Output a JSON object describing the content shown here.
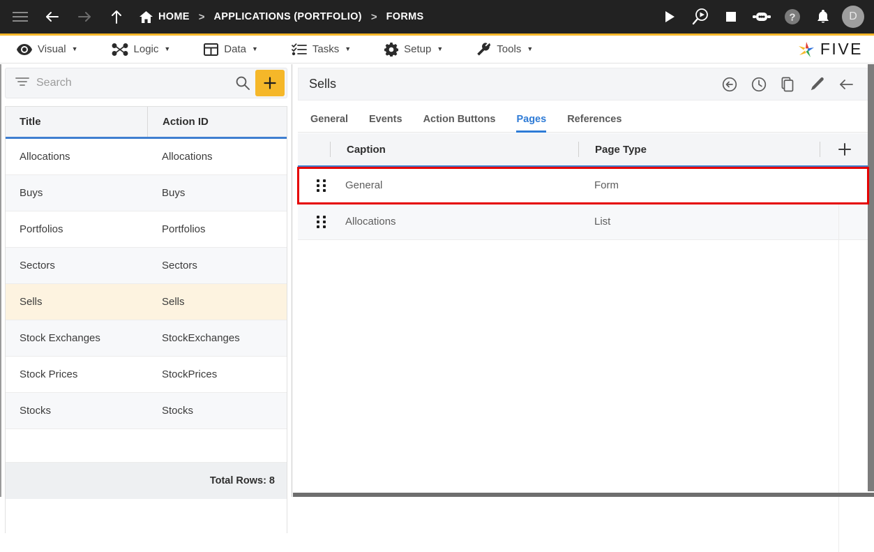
{
  "topbar": {
    "icons": [
      "menu-icon",
      "back-arrow-icon",
      "forward-arrow-icon",
      "up-arrow-icon"
    ],
    "home_label": "HOME",
    "sep": ">",
    "crumb2": "APPLICATIONS (PORTFOLIO)",
    "crumb3": "FORMS",
    "right_icons": [
      "play-icon",
      "debug-search-icon",
      "stop-icon",
      "chatbot-icon",
      "help-icon",
      "bell-icon"
    ],
    "avatar_initial": "D",
    "accent_color": "#f5b729",
    "background_color": "#222222"
  },
  "menubar": {
    "items": [
      {
        "label": "Visual",
        "icon": "eye-icon",
        "caret": "▼"
      },
      {
        "label": "Logic",
        "icon": "logic-nodes-icon",
        "caret": "▼"
      },
      {
        "label": "Data",
        "icon": "table-grid-icon",
        "caret": "▼"
      },
      {
        "label": "Tasks",
        "icon": "checklist-icon",
        "caret": "▼"
      },
      {
        "label": "Setup",
        "icon": "gear-icon",
        "caret": "▼"
      },
      {
        "label": "Tools",
        "icon": "tools-icon",
        "caret": "▼"
      }
    ],
    "logo_text": "FIVE",
    "logo_icon": "five-pinwheel-logo"
  },
  "sidebar": {
    "search": {
      "placeholder": "Search",
      "value": "",
      "filter_icon": "filter-icon",
      "search_icon": "search-icon"
    },
    "add_button": {
      "icon": "plus-icon",
      "label": "+",
      "color": "#f5b729"
    },
    "columns": [
      "Title",
      "Action ID"
    ],
    "rows": [
      {
        "title": "Allocations",
        "action_id": "Allocations"
      },
      {
        "title": "Buys",
        "action_id": "Buys"
      },
      {
        "title": "Portfolios",
        "action_id": "Portfolios"
      },
      {
        "title": "Sectors",
        "action_id": "Sectors"
      },
      {
        "title": "Sells",
        "action_id": "Sells"
      },
      {
        "title": "Stock Exchanges",
        "action_id": "StockExchanges"
      },
      {
        "title": "Stock Prices",
        "action_id": "StockPrices"
      },
      {
        "title": "Stocks",
        "action_id": "Stocks"
      }
    ],
    "selected_index": 4,
    "selected_color": "#fdf3e0",
    "footer": "Total Rows: 8"
  },
  "detail": {
    "title": "Sells",
    "header_icons": [
      "undo-circle-icon",
      "history-clock-icon",
      "copy-icon",
      "edit-pencil-icon",
      "back-arrow-icon"
    ],
    "tabs": [
      {
        "label": "General",
        "active": false
      },
      {
        "label": "Events",
        "active": false
      },
      {
        "label": "Action Buttons",
        "active": false
      },
      {
        "label": "Pages",
        "active": true
      },
      {
        "label": "References",
        "active": false
      }
    ],
    "active_tab_color": "#2e7bd6",
    "pages_table": {
      "columns": [
        "Caption",
        "Page Type"
      ],
      "add_icon": "plus-icon",
      "rows": [
        {
          "drag": "drag-handle-icon",
          "caption": "General",
          "page_type": "Form",
          "highlighted": true
        },
        {
          "drag": "drag-handle-icon",
          "caption": "Allocations",
          "page_type": "List",
          "highlighted": false
        }
      ],
      "highlight_color": "#e50000"
    }
  }
}
